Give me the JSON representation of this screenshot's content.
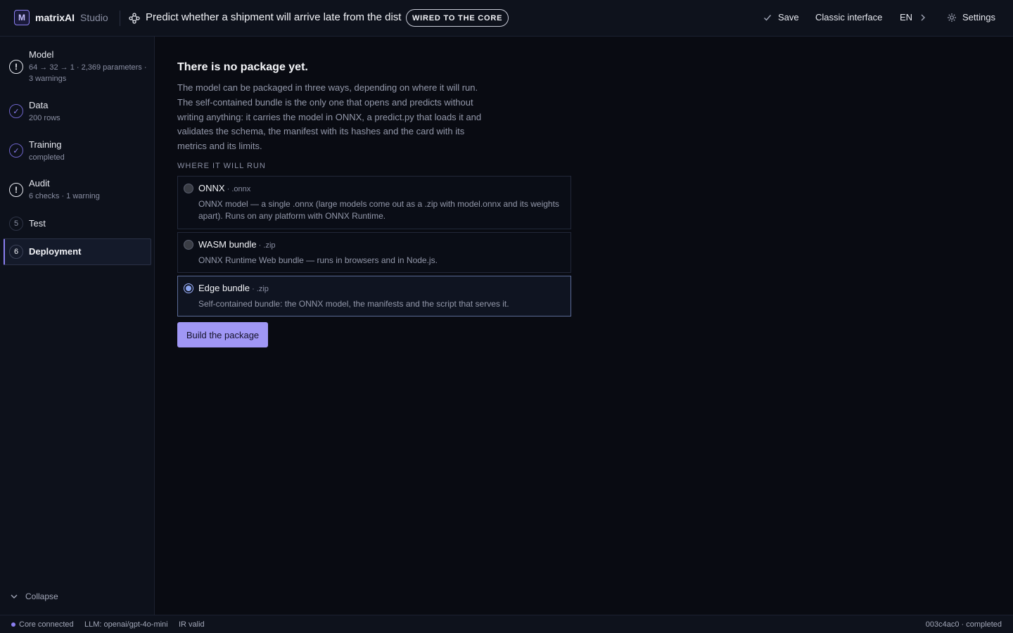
{
  "header": {
    "logo_letter": "M",
    "brand": "matrixAI",
    "brand_sub": "Studio",
    "project_title": "Predict whether a shipment will arrive late from the distanc",
    "badge": "WIRED TO THE CORE",
    "save_label": "Save",
    "classic_label": "Classic interface",
    "lang_label": "EN",
    "settings_label": "Settings"
  },
  "sidebar": {
    "steps": [
      {
        "marker": "!",
        "title": "Model",
        "sub": "64 → 32 → 1 · 2,369 parameters · 3 warnings",
        "state": "warning"
      },
      {
        "marker": "✓",
        "title": "Data",
        "sub": "200 rows",
        "state": "done"
      },
      {
        "marker": "✓",
        "title": "Training",
        "sub": "completed",
        "state": "done"
      },
      {
        "marker": "!",
        "title": "Audit",
        "sub": "6 checks · 1 warning",
        "state": "warning"
      },
      {
        "marker": "5",
        "title": "Test",
        "sub": "",
        "state": "pending"
      },
      {
        "marker": "6",
        "title": "Deployment",
        "sub": "",
        "state": "active"
      }
    ],
    "collapse_label": "Collapse"
  },
  "main": {
    "heading": "There is no package yet.",
    "description": "The model can be packaged in three ways, depending on where it will run. The self-contained bundle is the only one that opens and predicts without writing anything: it carries the model in ONNX, a predict.py that loads it and validates the schema, the manifest with its hashes and the card with its metrics and its limits.",
    "section_label": "WHERE IT WILL RUN",
    "options": [
      {
        "title": "ONNX",
        "ext": " · .onnx",
        "desc": "ONNX model — a single .onnx (large models come out as a .zip with model.onnx and its weights apart). Runs on any platform with ONNX Runtime.",
        "selected": false
      },
      {
        "title": "WASM bundle",
        "ext": " · .zip",
        "desc": "ONNX Runtime Web bundle — runs in browsers and in Node.js.",
        "selected": false
      },
      {
        "title": "Edge bundle",
        "ext": " · .zip",
        "desc": "Self-contained bundle: the ONNX model, the manifests and the script that serves it.",
        "selected": true
      }
    ],
    "build_label": "Build the package"
  },
  "statusbar": {
    "core": "Core connected",
    "llm": "LLM: openai/gpt-4o-mini",
    "ir": "IR valid",
    "run": "003c4ac0 · completed"
  },
  "colors": {
    "accent": "#8b7ff0",
    "background": "#090b12",
    "button": "#a097f5"
  }
}
